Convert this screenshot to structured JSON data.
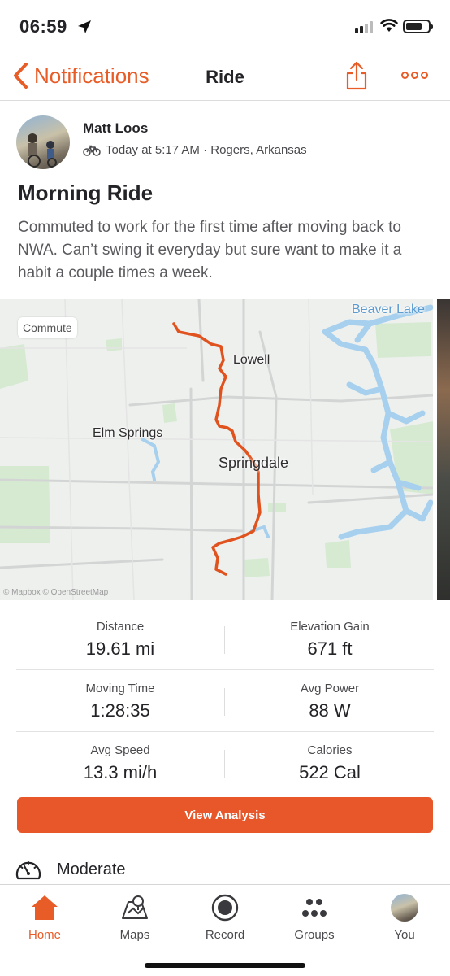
{
  "status_bar": {
    "time": "06:59"
  },
  "nav": {
    "back_label": "Notifications",
    "title": "Ride"
  },
  "athlete": {
    "name": "Matt Loos",
    "meta": "Today at 5:17 AM · Rogers, Arkansas"
  },
  "activity": {
    "title": "Morning Ride",
    "description": "Commuted to work for the first time after moving back to NWA. Can’t swing it everyday but sure want to make it a habit a couple times a week."
  },
  "map": {
    "tag": "Commute",
    "labels": {
      "lake": "Beaver Lake",
      "town1": "Lowell",
      "town2": "Elm Springs",
      "town3": "Springdale"
    },
    "attribution": "© Mapbox © OpenStreetMap",
    "route_color": "#e0531f"
  },
  "stats": [
    {
      "left": {
        "label": "Distance",
        "value": "19.61 mi"
      },
      "right": {
        "label": "Elevation Gain",
        "value": "671 ft"
      }
    },
    {
      "left": {
        "label": "Moving Time",
        "value": "1:28:35"
      },
      "right": {
        "label": "Avg Power",
        "value": "88 W"
      }
    },
    {
      "left": {
        "label": "Avg Speed",
        "value": "13.3 mi/h"
      },
      "right": {
        "label": "Calories",
        "value": "522 Cal"
      }
    }
  ],
  "analysis_button": "View Analysis",
  "effort": {
    "label": "Moderate",
    "icon": "gauge-icon"
  },
  "tabs": [
    {
      "label": "Home",
      "icon": "home-icon",
      "active": true
    },
    {
      "label": "Maps",
      "icon": "maps-icon"
    },
    {
      "label": "Record",
      "icon": "record-icon"
    },
    {
      "label": "Groups",
      "icon": "groups-icon"
    },
    {
      "label": "You",
      "icon": "avatar"
    }
  ],
  "colors": {
    "accent": "#e85c27",
    "button": "#e8572a"
  }
}
